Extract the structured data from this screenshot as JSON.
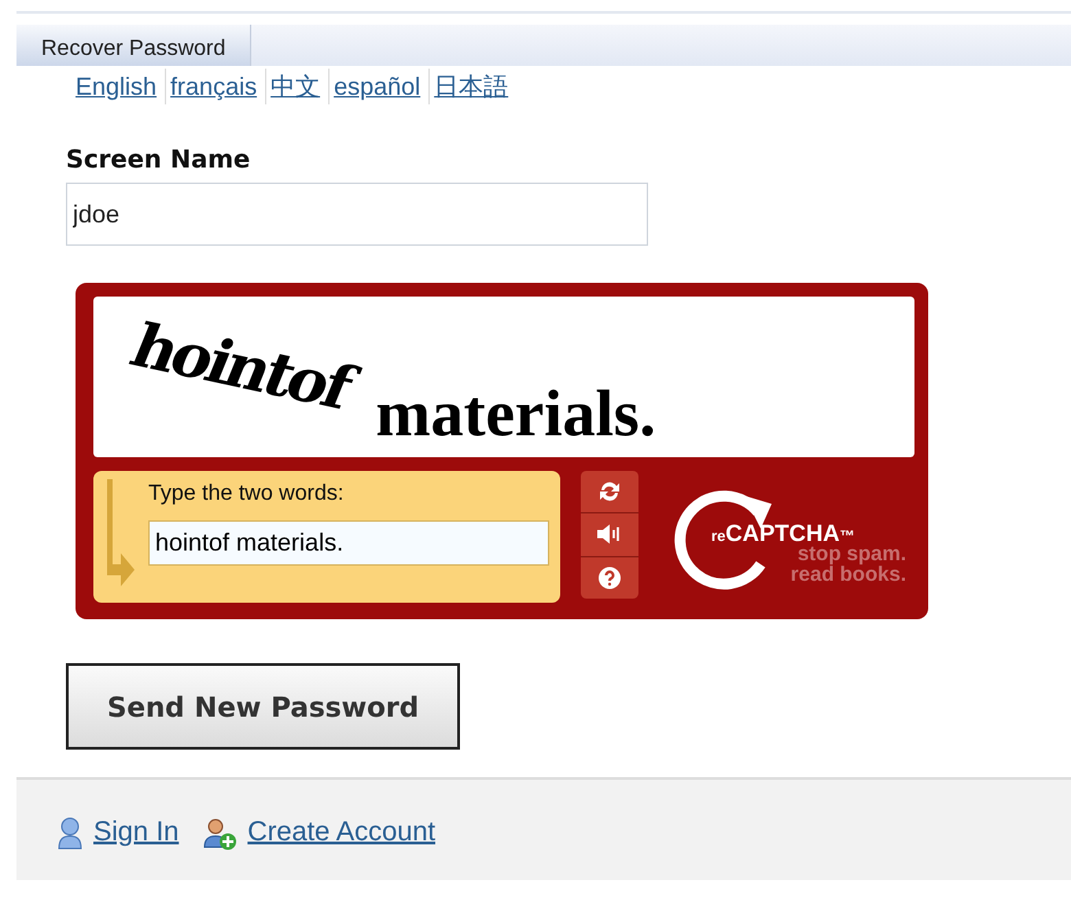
{
  "tabs": [
    {
      "label": "Recover Password",
      "selected": true
    }
  ],
  "languages": [
    "English",
    "français",
    "中文",
    "español",
    "日本語"
  ],
  "screen_name": {
    "label": "Screen Name",
    "value": "jdoe"
  },
  "captcha": {
    "words": [
      "hointof",
      "materials."
    ],
    "prompt": "Type the two words:",
    "value": "hointof materials.",
    "brand_prefix": "re",
    "brand": "CAPTCHA",
    "trademark": "™",
    "slogan": [
      "stop spam.",
      "read books."
    ]
  },
  "submit": "Send New Password",
  "footer_links": [
    {
      "label": "Sign In",
      "kind": "user"
    },
    {
      "label": "Create Account",
      "kind": "add-user"
    }
  ]
}
